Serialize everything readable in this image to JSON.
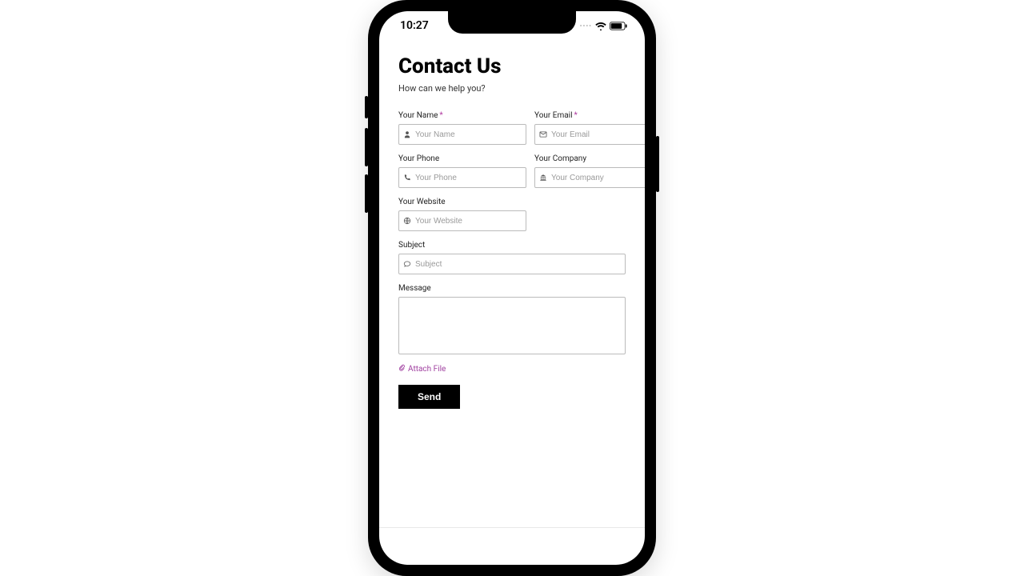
{
  "status": {
    "time": "10:27"
  },
  "header": {
    "title": "Contact Us",
    "subtitle": "How can we help you?"
  },
  "fields": {
    "name": {
      "label": "Your Name",
      "placeholder": "Your Name",
      "required": "*"
    },
    "email": {
      "label": "Your Email",
      "placeholder": "Your Email",
      "required": "*"
    },
    "phone": {
      "label": "Your Phone",
      "placeholder": "Your Phone"
    },
    "company": {
      "label": "Your Company",
      "placeholder": "Your Company"
    },
    "website": {
      "label": "Your Website",
      "placeholder": "Your Website"
    },
    "subject": {
      "label": "Subject",
      "placeholder": "Subject"
    },
    "message": {
      "label": "Message"
    }
  },
  "attach": {
    "label": "Attach File"
  },
  "actions": {
    "send": "Send"
  }
}
